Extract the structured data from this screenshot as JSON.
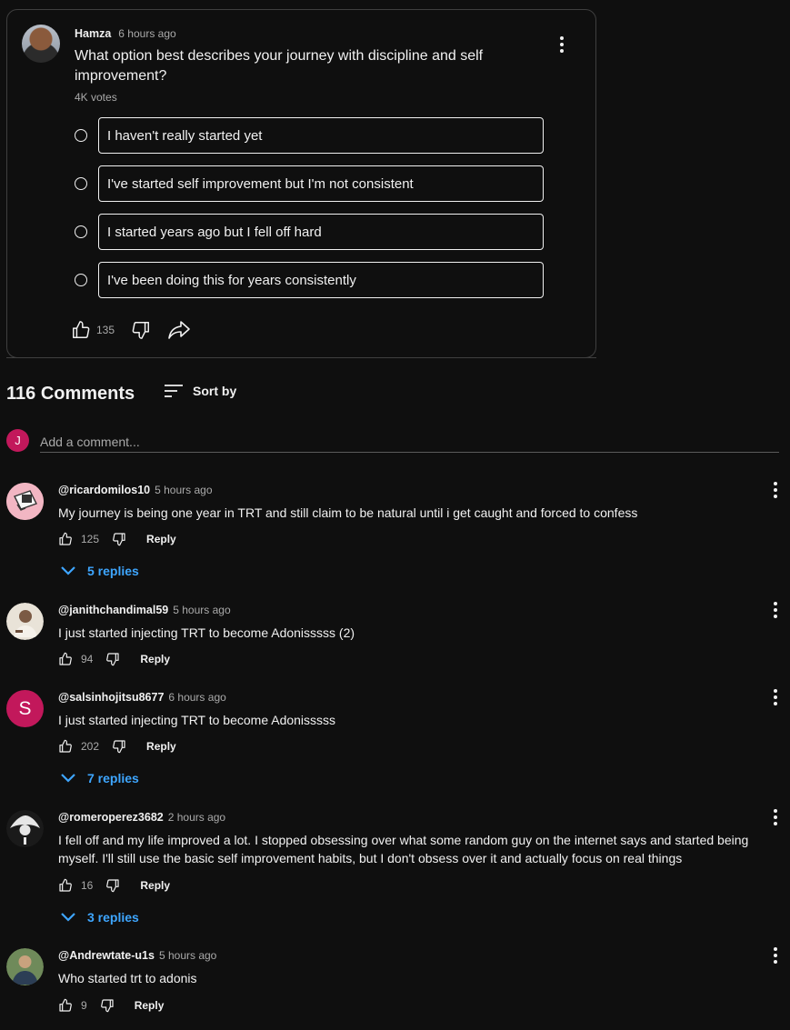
{
  "post": {
    "author": "Hamza",
    "time": "6 hours ago",
    "question": "What option best describes your journey with discipline and self improvement?",
    "votes": "4K votes",
    "options": [
      "I haven't really started yet",
      "I've started self improvement but I'm not consistent",
      "I started years ago but I fell off hard",
      "I've been doing this for years consistently"
    ],
    "like_count": "135"
  },
  "comments_header": {
    "count": "116 Comments",
    "sort_label": "Sort by"
  },
  "add_comment": {
    "avatar_letter": "J",
    "placeholder": "Add a comment..."
  },
  "comments": [
    {
      "user": "@ricardomilos10",
      "time": "5 hours ago",
      "text": "My journey is being one year in TRT and still claim to be natural until i get caught and forced to confess",
      "likes": "125",
      "reply_label": "Reply",
      "replies": "5 replies"
    },
    {
      "user": "@janithchandimal59",
      "time": "5 hours ago",
      "text": "I just started injecting TRT to become Adonisssss (2)",
      "likes": "94",
      "reply_label": "Reply"
    },
    {
      "user": "@salsinhojitsu8677",
      "time": "6 hours ago",
      "text": "I just started injecting TRT to become Adonisssss",
      "likes": "202",
      "reply_label": "Reply",
      "replies": "7 replies",
      "avatar_letter": "S"
    },
    {
      "user": "@romeroperez3682",
      "time": "2 hours ago",
      "text": "I fell off and my life improved a lot. I stopped obsessing over what some random guy on the internet says and started being myself. I'll still use the basic self improvement habits, but I don't obsess over it and actually focus on real things",
      "likes": "16",
      "reply_label": "Reply",
      "replies": "3 replies"
    },
    {
      "user": "@Andrewtate-u1s",
      "time": "5 hours ago",
      "text": "Who started trt to adonis",
      "likes": "9",
      "reply_label": "Reply"
    }
  ],
  "colors": {
    "background": "#0f0f0f",
    "text": "#f1f1f1",
    "muted": "#aaaaaa",
    "link_blue": "#3ea6ff",
    "avatar_pink": "#c2185b"
  },
  "icons": [
    "kebab-menu-icon",
    "thumbs-up-icon",
    "thumbs-down-icon",
    "share-icon",
    "sort-icon",
    "chevron-down-icon"
  ]
}
